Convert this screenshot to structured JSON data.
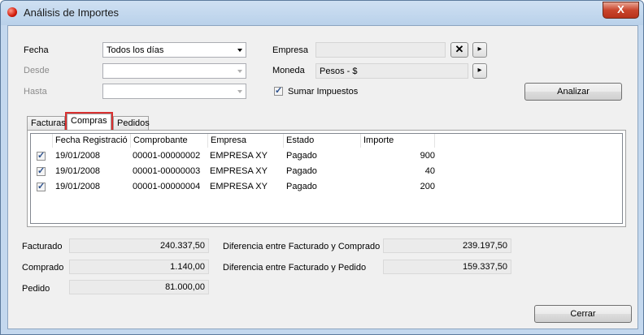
{
  "window": {
    "title": "Análisis de Importes",
    "close_glyph": "X"
  },
  "filters": {
    "fecha_label": "Fecha",
    "fecha_value": "Todos los días",
    "desde_label": "Desde",
    "hasta_label": "Hasta",
    "empresa_label": "Empresa",
    "moneda_label": "Moneda",
    "moneda_value": "Pesos - $",
    "sumar_label": "Sumar Impuestos",
    "sumar_checked": true,
    "clear_glyph": "✕",
    "next_glyph": "▸",
    "analizar_label": "Analizar"
  },
  "tabs": [
    {
      "label": "Facturas",
      "active": false
    },
    {
      "label": "Compras",
      "active": true
    },
    {
      "label": "Pedidos",
      "active": false
    }
  ],
  "table": {
    "columns": [
      "Fecha Registració",
      "Comprobante",
      "Empresa",
      "Estado",
      "Importe"
    ],
    "rows": [
      {
        "checked": true,
        "fecha": "19/01/2008",
        "comprobante": "00001-00000002",
        "empresa": "EMPRESA XY",
        "estado": "Pagado",
        "importe": "900"
      },
      {
        "checked": true,
        "fecha": "19/01/2008",
        "comprobante": "00001-00000003",
        "empresa": "EMPRESA XY",
        "estado": "Pagado",
        "importe": "40"
      },
      {
        "checked": true,
        "fecha": "19/01/2008",
        "comprobante": "00001-00000004",
        "empresa": "EMPRESA XY",
        "estado": "Pagado",
        "importe": "200"
      }
    ]
  },
  "totals": {
    "facturado_label": "Facturado",
    "facturado_value": "240.337,50",
    "comprado_label": "Comprado",
    "comprado_value": "1.140,00",
    "pedido_label": "Pedido",
    "pedido_value": "81.000,00",
    "dif_compra_label": "Diferencia entre Facturado y Comprado",
    "dif_compra_value": "239.197,50",
    "dif_pedido_label": "Diferencia entre Facturado y Pedido",
    "dif_pedido_value": "159.337,50"
  },
  "footer": {
    "cerrar_label": "Cerrar"
  },
  "icons": {
    "app": "red-circle-app-icon",
    "checkbox": "checkmark-icon",
    "dropdown": "chevron-down-icon"
  }
}
